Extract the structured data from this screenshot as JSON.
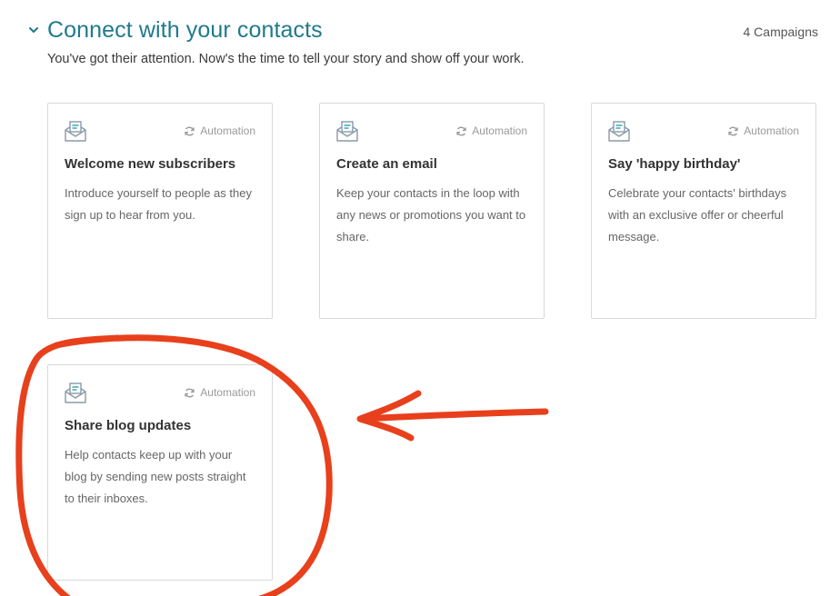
{
  "section": {
    "title": "Connect with your contacts",
    "count_label": "4 Campaigns",
    "subtitle": "You've got their attention. Now's the time to tell your story and show off your work."
  },
  "cards": [
    {
      "type_label": "Automation",
      "title": "Welcome new subscribers",
      "description": "Introduce yourself to people as they sign up to hear from you.",
      "icon": "envelope-icon"
    },
    {
      "type_label": "Automation",
      "title": "Create an email",
      "description": "Keep your contacts in the loop with any news or promotions you want to share.",
      "icon": "envelope-icon"
    },
    {
      "type_label": "Automation",
      "title": "Say 'happy birthday'",
      "description": "Celebrate your contacts' birthdays with an exclusive offer or cheerful message.",
      "icon": "envelope-icon"
    },
    {
      "type_label": "Automation",
      "title": "Share blog updates",
      "description": "Help contacts keep up with your blog by sending new posts straight to their inboxes.",
      "icon": "envelope-icon"
    }
  ],
  "colors": {
    "title": "#1f7a8c",
    "annotation": "#e8401c",
    "icon": "#8a9aa6",
    "icon_accent": "#2a9fb3"
  }
}
